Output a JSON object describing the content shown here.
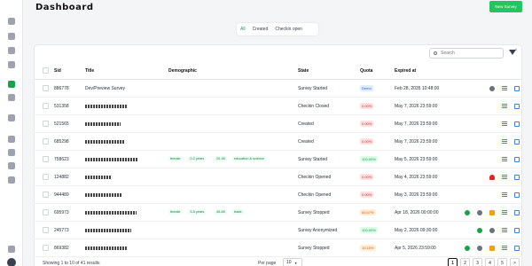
{
  "header": {
    "brand": "Dashboard",
    "new_button": "New Survey"
  },
  "tabs": [
    {
      "label": "All"
    },
    {
      "label": "Created"
    },
    {
      "label": "Checkin open"
    }
  ],
  "search": {
    "placeholder": "Search"
  },
  "filter": {
    "count": "0"
  },
  "columns": {
    "sid": "Sid",
    "title": "Title",
    "demographic": "Demographic",
    "state": "State",
    "quota": "Quota",
    "expired": "Expired at"
  },
  "rows": [
    {
      "sid": "886778",
      "title": "Dev/Preview Survey",
      "tags": [],
      "state": "Survey Started",
      "quota": "Demo",
      "quota_kind": "blue",
      "expired": "Feb 28, 2035 10:48:00",
      "actions": [
        "gear",
        "grid",
        "link"
      ]
    },
    {
      "sid": "531358",
      "title": "",
      "tags": [],
      "state": "Checkin Closed",
      "quota": "0.00%",
      "quota_kind": "red",
      "expired": "May 7, 2026 23:59:00",
      "actions": [
        "grid",
        "link"
      ]
    },
    {
      "sid": "521565",
      "title": "",
      "tags": [],
      "state": "Created",
      "quota": "0.00%",
      "quota_kind": "red",
      "expired": "May 7, 2026 23:59:00",
      "actions": [
        "grid",
        "link"
      ]
    },
    {
      "sid": "685298",
      "title": "",
      "tags": [],
      "state": "Created",
      "quota": "0.00%",
      "quota_kind": "red",
      "expired": "May 7, 2026 23:59:00",
      "actions": [
        "grid",
        "link"
      ]
    },
    {
      "sid": "758623",
      "title": "",
      "tags": [
        "female",
        "0-2 years",
        "20-35",
        "education & science"
      ],
      "state": "Survey Started",
      "quota": "100.00%",
      "quota_kind": "green",
      "expired": "May 5, 2026 23:59:00",
      "actions": [
        "grid",
        "link"
      ]
    },
    {
      "sid": "124882",
      "title": "",
      "tags": [],
      "state": "Checkin Opened",
      "quota": "0.00%",
      "quota_kind": "red",
      "expired": "May 4, 2026 23:59:00",
      "actions": [
        "alert",
        "grid",
        "link"
      ]
    },
    {
      "sid": "944489",
      "title": "",
      "tags": [],
      "state": "Checkin Opened",
      "quota": "0.00%",
      "quota_kind": "red",
      "expired": "May 3, 2026 23:59:00",
      "actions": [
        "grid",
        "link"
      ]
    },
    {
      "sid": "695973",
      "title": "",
      "tags": [
        "female",
        "3-5 years",
        "45-65",
        "trade"
      ],
      "state": "Survey Stopped",
      "quota": "66.67%",
      "quota_kind": "orange",
      "expired": "Apr 18, 2026 00:00:00",
      "actions": [
        "clone",
        "gear",
        "flag",
        "grid",
        "link"
      ]
    },
    {
      "sid": "245773",
      "title": "",
      "tags": [],
      "state": "Survey Anonymized",
      "quota": "100.00%",
      "quota_kind": "green",
      "expired": "May 2, 2026 09:30:00",
      "actions": [
        "clone",
        "gear",
        "grid",
        "link"
      ]
    },
    {
      "sid": "869382",
      "title": "",
      "tags": [],
      "state": "Survey Stopped",
      "quota": "15.15%",
      "quota_kind": "orange",
      "expired": "Apr 5, 2026 23:59:00",
      "actions": [
        "clone",
        "gear",
        "flag",
        "grid",
        "link"
      ]
    }
  ],
  "footer": {
    "showing": "Showing 1 to 10 of 41 results",
    "per_page_label": "Per page",
    "per_page_value": "10"
  },
  "pagination": [
    "1",
    "2",
    "3",
    "4",
    "5",
    ">"
  ],
  "colors": {
    "accent": "#22c55e",
    "link": "#3b82f6"
  }
}
